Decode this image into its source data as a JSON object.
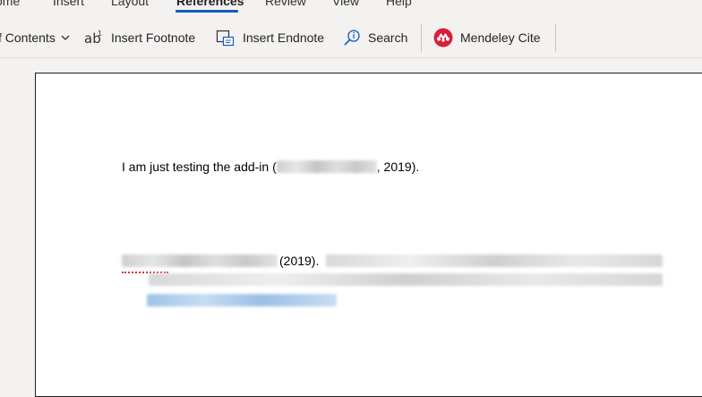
{
  "tabs": [
    {
      "label": "ome",
      "active": false
    },
    {
      "label": "Insert",
      "active": false
    },
    {
      "label": "Layout",
      "active": false
    },
    {
      "label": "References",
      "active": true
    },
    {
      "label": "Review",
      "active": false
    },
    {
      "label": "View",
      "active": false
    },
    {
      "label": "Help",
      "active": false
    }
  ],
  "ribbon": {
    "toc_label": "f Contents",
    "insert_footnote": "Insert Footnote",
    "insert_endnote": "Insert Endnote",
    "search": "Search",
    "mendeley_cite": "Mendeley Cite"
  },
  "document": {
    "line1_prefix": "I am just testing the add-in (",
    "line1_suffix": ", 2019).",
    "ref_year": "(2019)."
  },
  "colors": {
    "accent": "#185abd",
    "mendeley": "#d71f3e"
  }
}
